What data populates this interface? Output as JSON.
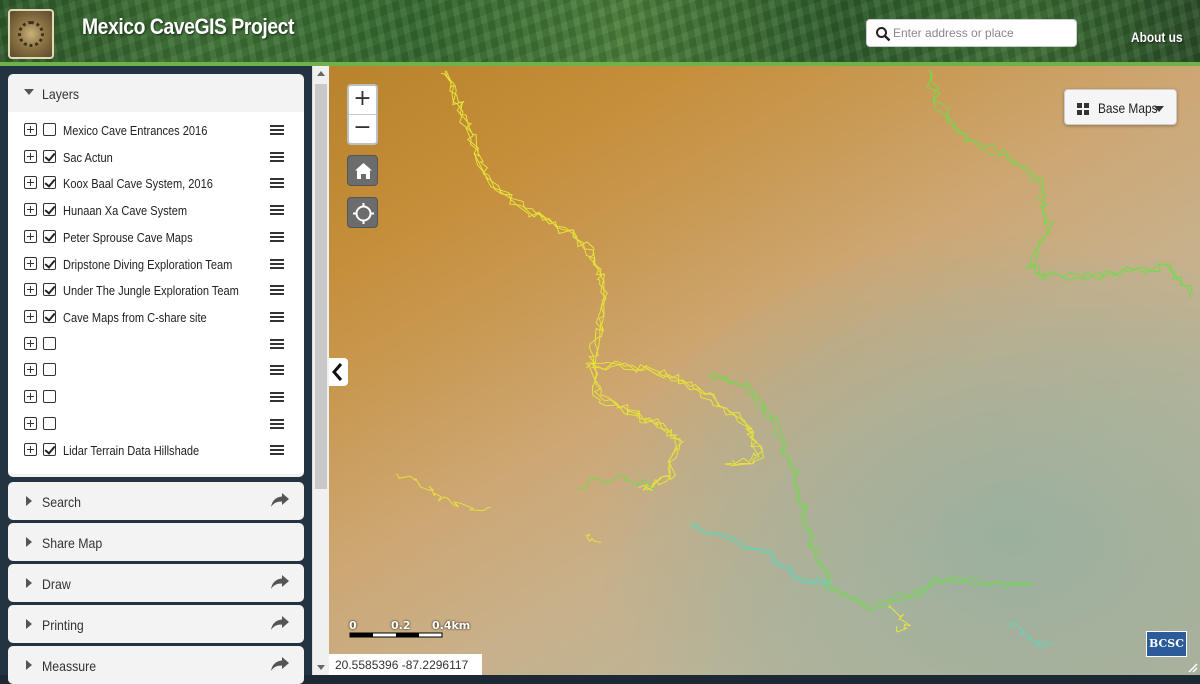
{
  "header": {
    "title": "Mexico CaveGIS Project",
    "search_placeholder": "Enter address or place",
    "about_label": "About us"
  },
  "sidebar": {
    "layers_panel": {
      "title": "Layers",
      "layers": [
        {
          "label": "Mexico Cave Entrances 2016",
          "checked": false
        },
        {
          "label": "Sac Actun",
          "checked": true
        },
        {
          "label": "Koox Baal Cave System, 2016",
          "checked": true
        },
        {
          "label": "Hunaan Xa Cave System",
          "checked": true
        },
        {
          "label": "Peter Sprouse Cave Maps",
          "checked": true
        },
        {
          "label": "Dripstone Diving Exploration Team",
          "checked": true
        },
        {
          "label": "Under The Jungle Exploration Team",
          "checked": true
        },
        {
          "label": "Cave Maps from C-share site",
          "checked": true
        },
        {
          "label": "",
          "checked": false
        },
        {
          "label": "",
          "checked": false
        },
        {
          "label": "",
          "checked": false
        },
        {
          "label": "",
          "checked": false
        },
        {
          "label": "Lidar Terrain Data Hillshade",
          "checked": true
        }
      ]
    },
    "panels": [
      {
        "title": "Search",
        "share_icon": true
      },
      {
        "title": "Share Map",
        "share_icon": false
      },
      {
        "title": "Draw",
        "share_icon": true
      },
      {
        "title": "Printing",
        "share_icon": true
      },
      {
        "title": "Meassure",
        "share_icon": true
      }
    ]
  },
  "map": {
    "zoom_in_label": "+",
    "zoom_out_label": "−",
    "home_icon": "home-icon",
    "locate_icon": "crosshair-icon",
    "base_maps_label": "Base Maps",
    "scale_labels": [
      "0",
      "0.2",
      "0.4km"
    ],
    "coordinates": "20.5585396  -87.2296117",
    "attribution_logo_text": "BCSC",
    "colors": {
      "cave_yellow": "#e6e23a",
      "cave_green": "#6fdc4a",
      "cave_teal": "#5fd6b8",
      "sidebar_bg": "#233342",
      "header_border": "#6fb24a"
    }
  }
}
